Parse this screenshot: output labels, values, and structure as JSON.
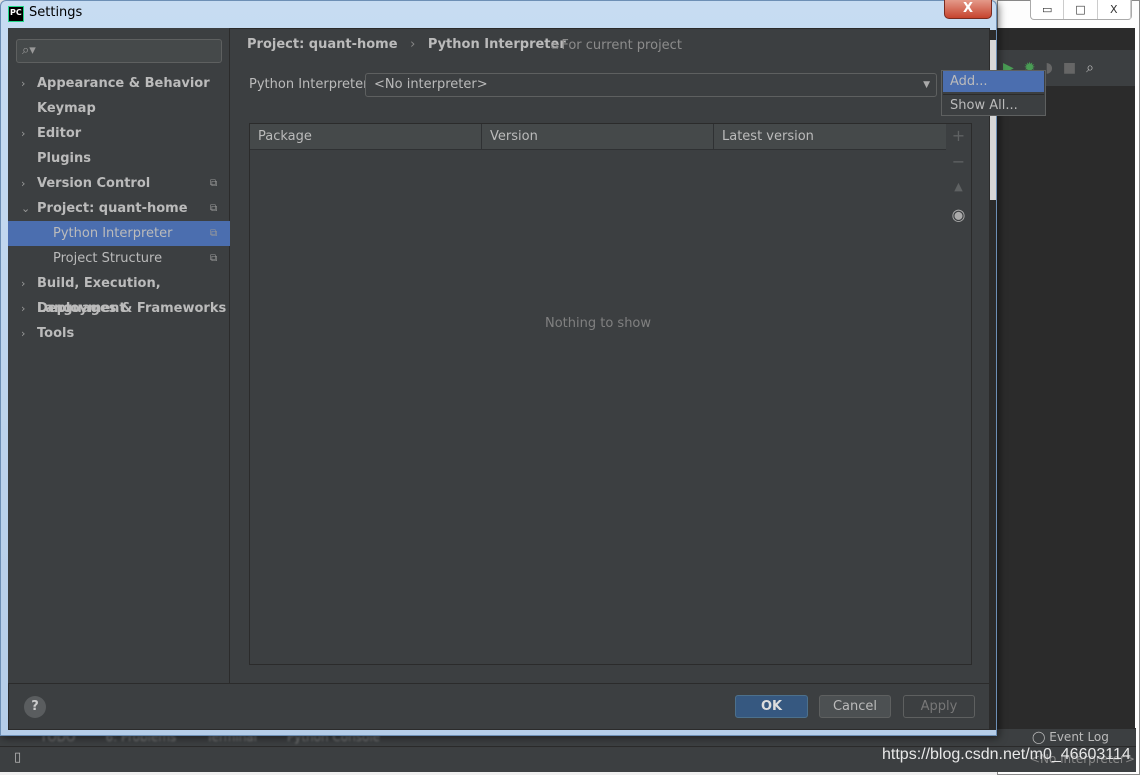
{
  "window": {
    "title": "Settings",
    "app_icon": "PC",
    "close_label": "X"
  },
  "ide": {
    "window_buttons": [
      "▭",
      "□",
      "X"
    ],
    "toolbar_icons": [
      "run-icon",
      "debug-icon",
      "coverage-icon",
      "stop-icon",
      "search-icon"
    ],
    "bottom_tabs": [
      "TODO",
      "6: Problems",
      "Terminal",
      "Python Console"
    ],
    "event_log": "Event Log",
    "status_interpreter": "<No interpreter>"
  },
  "watermark": "https://blog.csdn.net/m0_46603114",
  "search": {
    "placeholder": "",
    "icon": "search-icon"
  },
  "sidebar": {
    "items": [
      {
        "label": "Appearance & Behavior",
        "chevron": "›",
        "level": 0
      },
      {
        "label": "Keymap",
        "chevron": "",
        "level": 0
      },
      {
        "label": "Editor",
        "chevron": "›",
        "level": 0
      },
      {
        "label": "Plugins",
        "chevron": "",
        "level": 0
      },
      {
        "label": "Version Control",
        "chevron": "›",
        "level": 0,
        "copy": true
      },
      {
        "label": "Project: quant-home",
        "chevron": "⌄",
        "level": 0,
        "copy": true
      },
      {
        "label": "Python Interpreter",
        "level": 1,
        "copy": true,
        "selected": true
      },
      {
        "label": "Project Structure",
        "level": 1,
        "copy": true
      },
      {
        "label": "Build, Execution, Deployment",
        "chevron": "›",
        "level": 0
      },
      {
        "label": "Languages & Frameworks",
        "chevron": "›",
        "level": 0
      },
      {
        "label": "Tools",
        "chevron": "›",
        "level": 0
      }
    ]
  },
  "breadcrumb": {
    "parent": "Project: quant-home",
    "sep": "›",
    "current": "Python Interpreter",
    "scope": "For current project"
  },
  "interpreter": {
    "label": "Python Interpreter:",
    "value": "<No interpreter>"
  },
  "popup": {
    "items": [
      "Add...",
      "Show All..."
    ],
    "highlighted": "Add..."
  },
  "table": {
    "columns": [
      "Package",
      "Version",
      "Latest version"
    ],
    "empty_text": "Nothing to show"
  },
  "table_tools": [
    "+",
    "−",
    "▲",
    "◉"
  ],
  "buttons": {
    "help": "?",
    "ok": "OK",
    "cancel": "Cancel",
    "apply": "Apply"
  },
  "colors": {
    "selection": "#4b6eaf",
    "ok_button": "#365880",
    "background": "#3c3f41"
  }
}
